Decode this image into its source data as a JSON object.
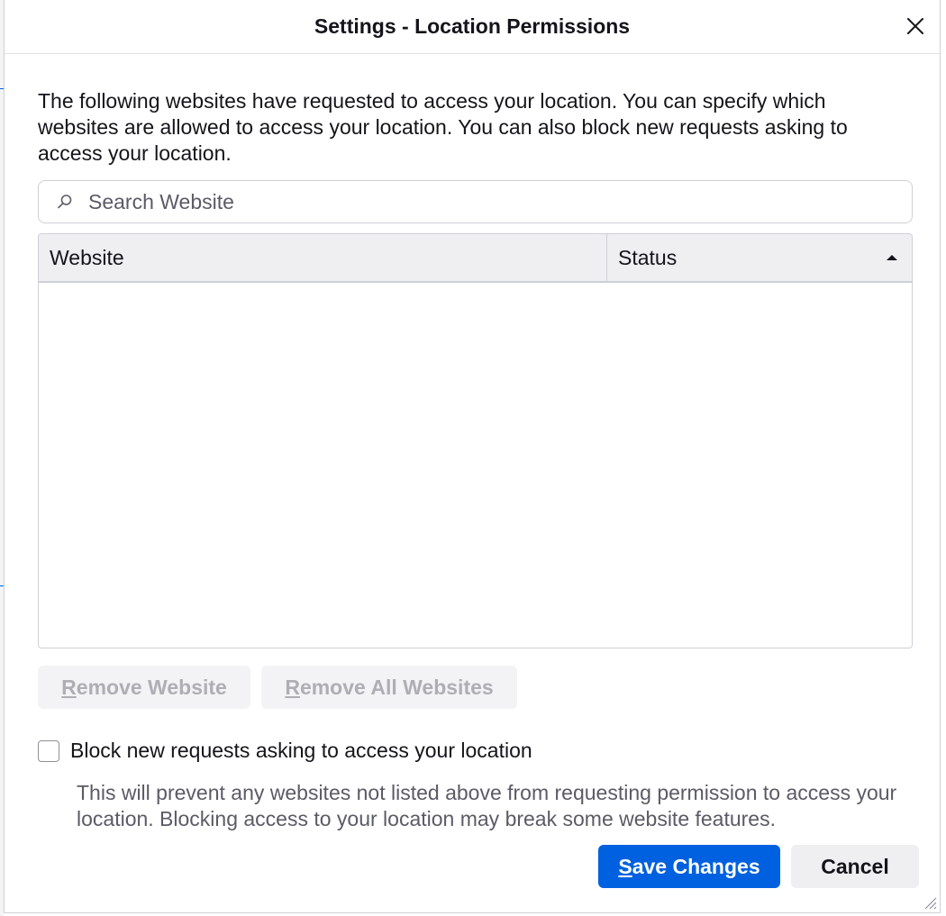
{
  "dialog": {
    "title": "Settings - Location Permissions",
    "close_icon": "close-icon"
  },
  "description": "The following websites have requested to access your location. You can specify which websites are allowed to access your location. You can also block new requests asking to access your location.",
  "search": {
    "placeholder": "Search Website",
    "value": "",
    "icon": "search-icon"
  },
  "table": {
    "columns": [
      {
        "label": "Website"
      },
      {
        "label": "Status",
        "sort": "ascending"
      }
    ],
    "rows": []
  },
  "buttons": {
    "remove_website": {
      "key": "R",
      "rest": "emove Website",
      "enabled": false
    },
    "remove_all": {
      "key": "R",
      "rest": "emove All Websites",
      "enabled": false
    },
    "save": {
      "key": "S",
      "rest": "ave Changes"
    },
    "cancel": {
      "label": "Cancel"
    }
  },
  "block_option": {
    "label": "Block new requests asking to access your location",
    "checked": false,
    "hint": "This will prevent any websites not listed above from requesting permission to access your location. Blocking access to your location may break some website features."
  },
  "colors": {
    "primary": "#0061e0",
    "border": "#cfcfd8",
    "header_bg": "#efeff2",
    "disabled_text": "#aeaeb5",
    "hint_text": "#5b5b66"
  }
}
